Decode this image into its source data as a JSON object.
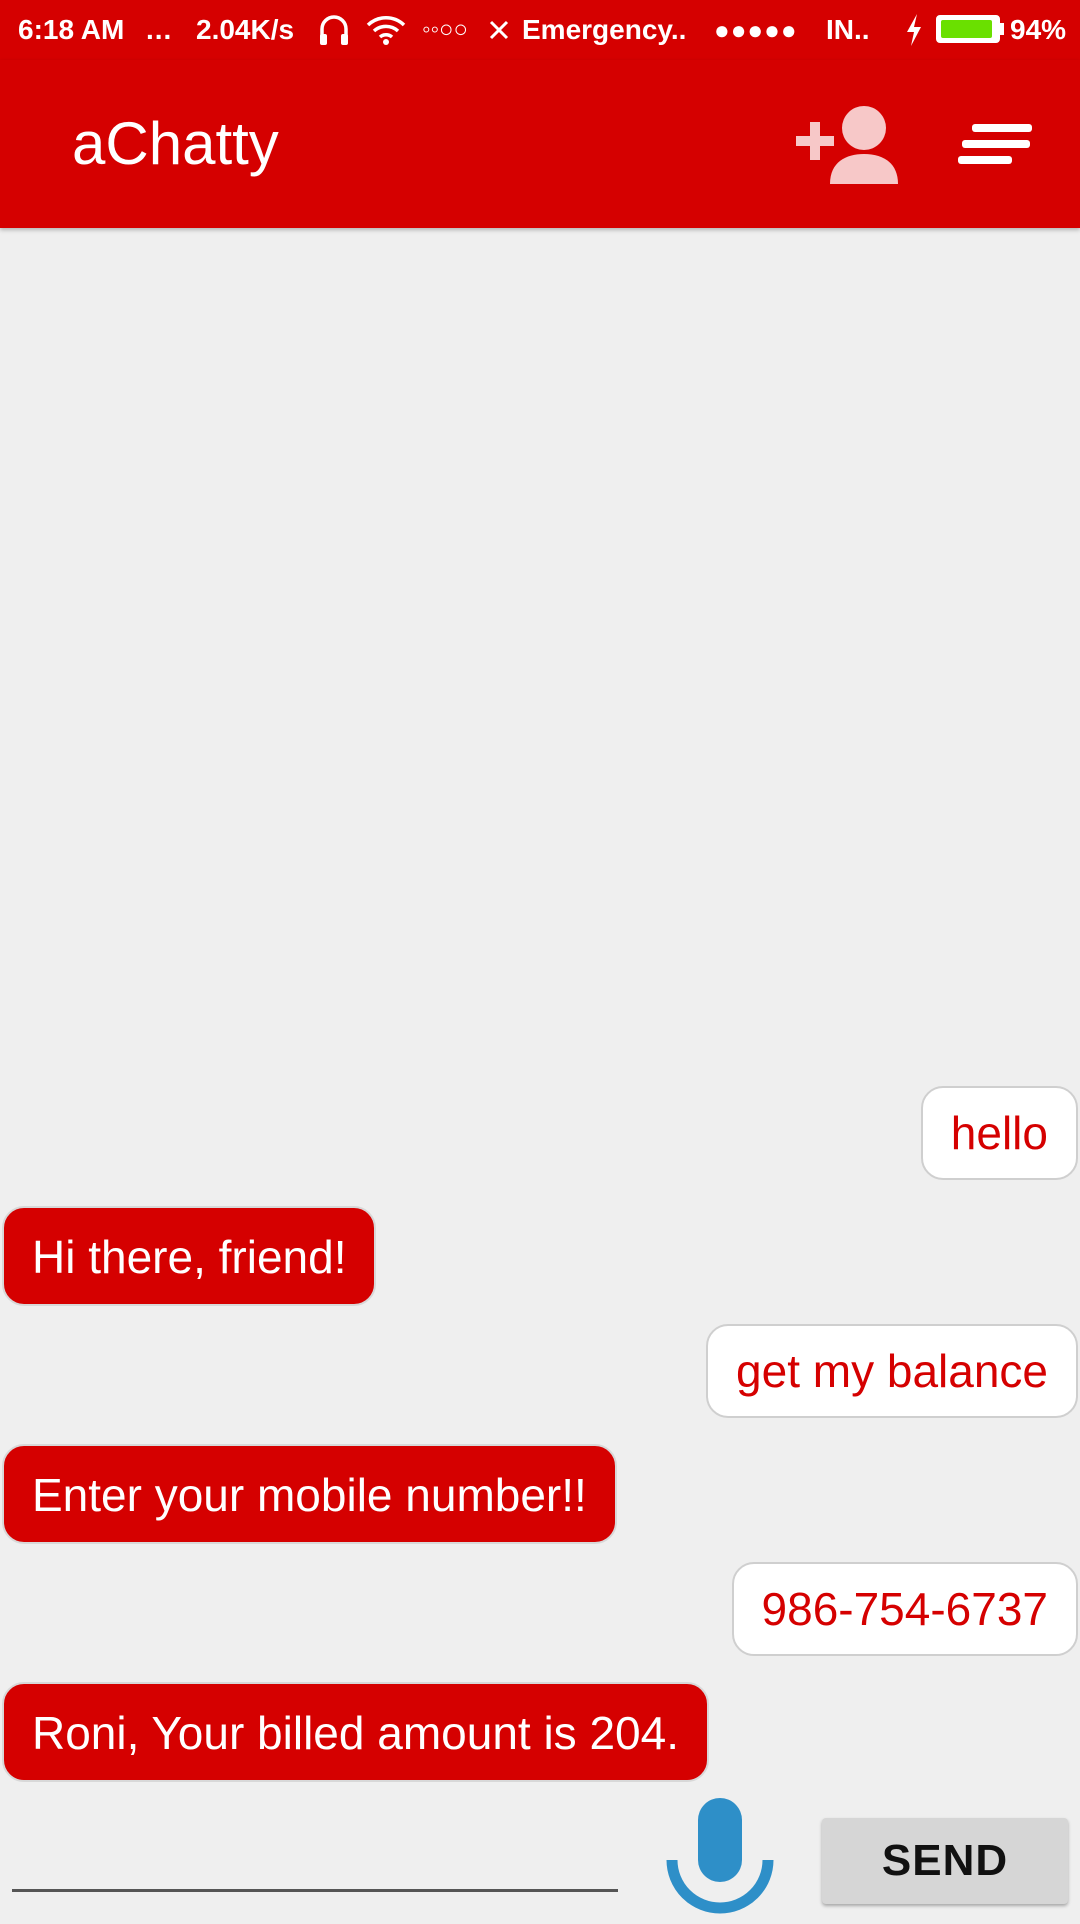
{
  "status_bar": {
    "time": "6:18 AM",
    "dots": "...",
    "speed": "2.04K/s",
    "carrier_signal": "◦◦○○",
    "carrier": "Emergency..",
    "signal2": "●●●●●",
    "carrier2": "IN..",
    "battery_percent": "94%",
    "battery_level": 0.94,
    "icons": [
      "headphones-icon",
      "wifi-icon",
      "no-signal-icon",
      "charging-icon",
      "battery-icon"
    ]
  },
  "app_bar": {
    "title": "aChatty",
    "icons": [
      "add-user-icon",
      "menu-icon"
    ]
  },
  "colors": {
    "brand": "#d50000",
    "background": "#efefef",
    "mic": "#2e8fc8",
    "battery": "#6ae000"
  },
  "messages": [
    {
      "from": "user",
      "text": "hello"
    },
    {
      "from": "bot",
      "text": "Hi there, friend!"
    },
    {
      "from": "user",
      "text": "get my balance"
    },
    {
      "from": "bot",
      "text": "Enter your mobile number!!"
    },
    {
      "from": "user",
      "text": "986-754-6737"
    },
    {
      "from": "bot",
      "text": "Roni, Your billed amount is 204."
    }
  ],
  "composer": {
    "input_value": "",
    "mic_icon": "microphone-icon",
    "send_label": "SEND"
  }
}
